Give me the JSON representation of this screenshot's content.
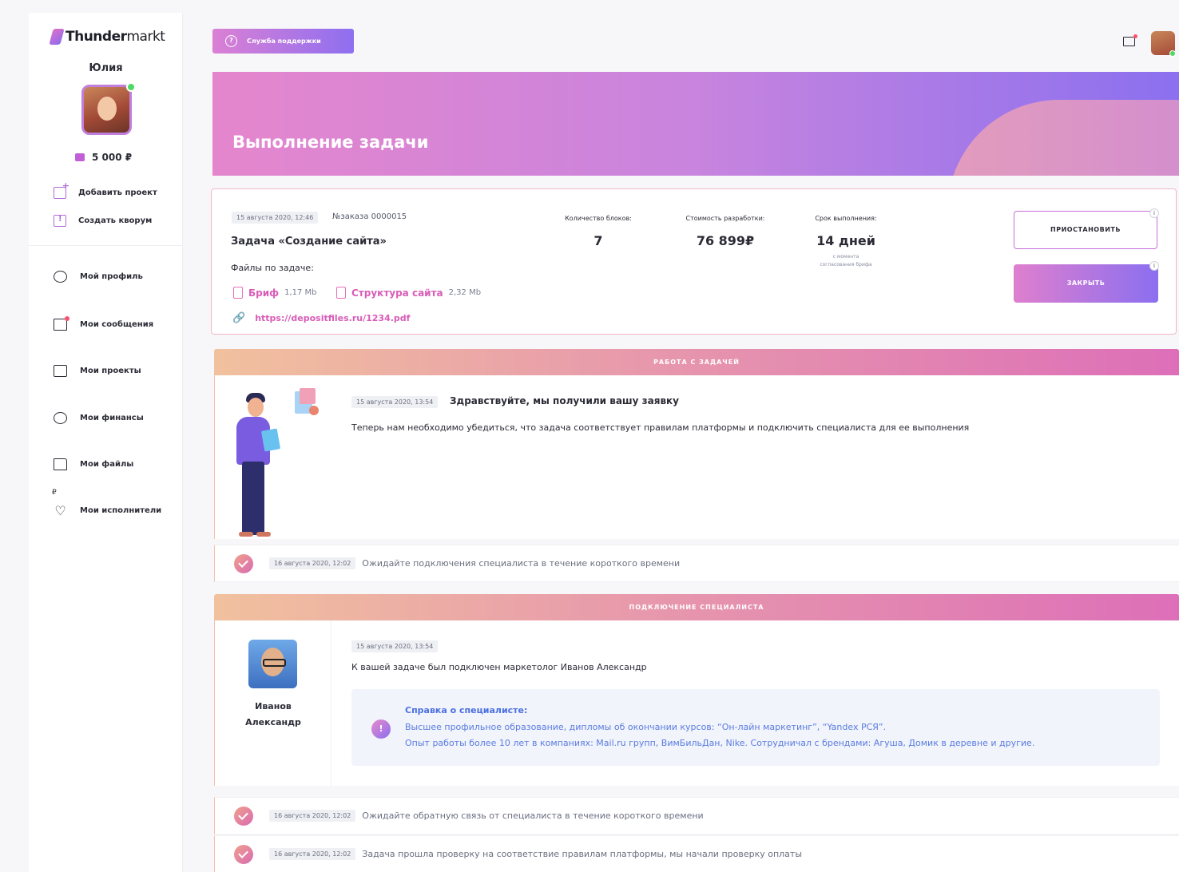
{
  "brand": {
    "logo_bold": "Thunder",
    "logo_light": "markt"
  },
  "user": {
    "name": "Юлия",
    "balance": "5 000 ₽"
  },
  "sidebar": {
    "actions": [
      {
        "label": "Добавить проект",
        "icon": "add-chart-icon"
      },
      {
        "label": "Создать кворум",
        "icon": "quorum-icon"
      }
    ],
    "nav": [
      {
        "label": "Мой профиль",
        "icon": "profile-icon"
      },
      {
        "label": "Мои сообщения",
        "icon": "mail-icon"
      },
      {
        "label": "Мои проекты",
        "icon": "projects-icon"
      },
      {
        "label": "Мои финансы",
        "icon": "finance-icon"
      },
      {
        "label": "Мои файлы",
        "icon": "folder-icon"
      },
      {
        "label": "Мои исполнители",
        "icon": "heart-icon"
      }
    ],
    "currency_mark": "₽"
  },
  "header": {
    "support_label": "Служба поддержки",
    "support_icon": "?"
  },
  "hero": {
    "title": "Выполнение задачи"
  },
  "task": {
    "date": "15 августа 2020, 12:46",
    "order": "№заказа 0000015",
    "title": "Задача «Создание сайта»",
    "files_label": "Файлы по задаче:",
    "files": [
      {
        "name": "Бриф",
        "size": "1,17 Mb"
      },
      {
        "name": "Структура сайта",
        "size": "2,32 Mb"
      }
    ],
    "link": "https://depositfiles.ru/1234.pdf",
    "stats": [
      {
        "label": "Количество блоков:",
        "value": "7",
        "sub": ""
      },
      {
        "label": "Стоимость разработки:",
        "value": "76 899₽",
        "sub": ""
      },
      {
        "label": "Срок выполнения:",
        "value": "14 дней",
        "sub1": "с момента",
        "sub2": "согласования брифа"
      }
    ],
    "pause_label": "ПРИОСТАНОВИТЬ",
    "close_label": "ЗАКРЫТЬ",
    "info_glyph": "i"
  },
  "section1": {
    "header": "РАБОТА С ЗАДАЧЕЙ",
    "message": {
      "date": "15 августа 2020, 13:54",
      "title": "Здравствуйте, мы получили вашу заявку",
      "text": "Теперь нам необходимо убедиться, что задача соответствует правилам платформы и подключить специалиста для ее выполнения"
    },
    "status": {
      "date": "16 августа 2020, 12:02",
      "text": "Ожидайте подключения специалиста в течение короткого времени"
    }
  },
  "section2": {
    "header": "ПОДКЛЮЧЕНИЕ СПЕЦИАЛИСТА",
    "specialist": {
      "first": "Иванов",
      "last": "Александр"
    },
    "message": {
      "date": "15 августа 2020, 13:54",
      "text": "К вашей задаче был подключен маркетолог Иванов Александр"
    },
    "reference": {
      "glyph": "!",
      "title": "Справка о специалисте:",
      "line1": "Высшее профильное образование, дипломы об окончании курсов: “Он-лайн маркетинг”, “Yandex РСЯ”.",
      "line2": "Опыт работы более 10 лет в компаниях: Mail.ru групп, ВимБильДан, Nike. Сотрудничал с брендами: Агуша, Домик в деревне и другие."
    },
    "statuses": [
      {
        "date": "16 августа 2020, 12:02",
        "text": "Ожидайте обратную связь от специалиста в течение короткого времени"
      },
      {
        "date": "16 августа 2020, 12:02",
        "text": "Задача прошла проверку на соответствие правилам платформы, мы начали проверку оплаты"
      }
    ]
  }
}
